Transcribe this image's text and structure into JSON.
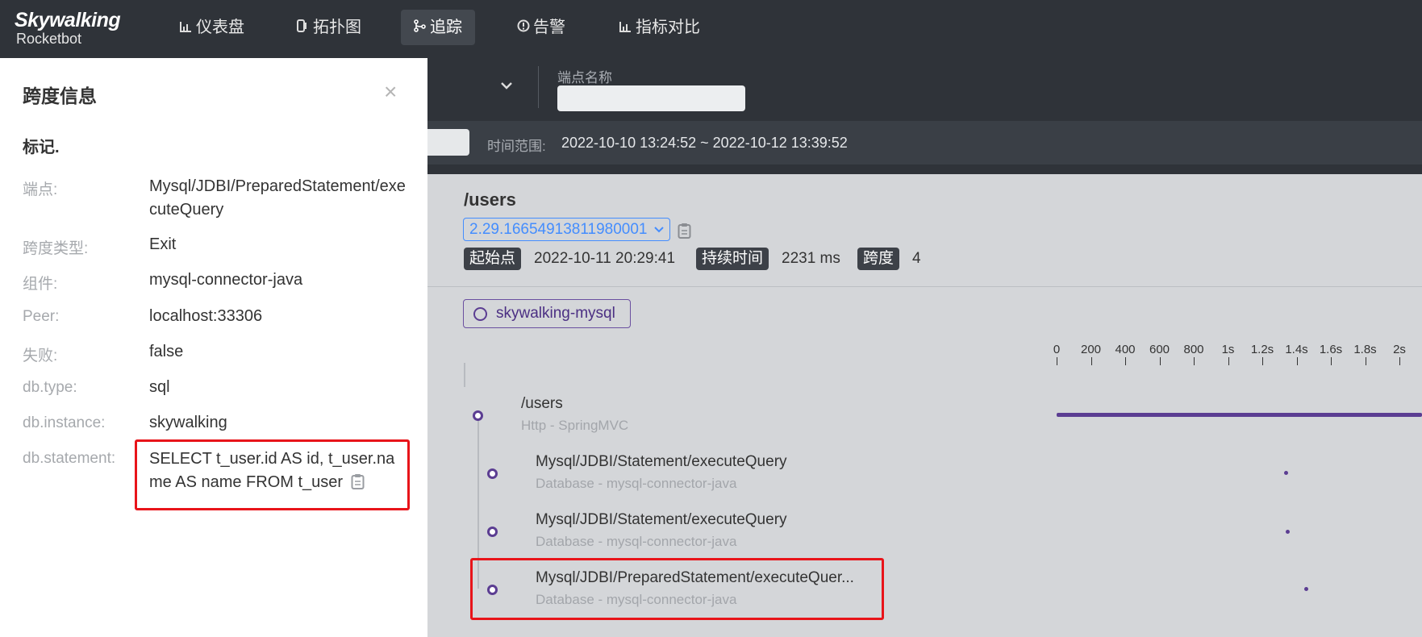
{
  "nav": {
    "logo_line1": "Skywalking",
    "logo_line2": "Rocketbot",
    "items": [
      {
        "label": "仪表盘",
        "icon": "bar-chart-icon"
      },
      {
        "label": "拓扑图",
        "icon": "topology-icon"
      },
      {
        "label": "追踪",
        "icon": "trace-icon",
        "active": true
      },
      {
        "label": "告警",
        "icon": "alarm-icon"
      },
      {
        "label": "指标对比",
        "icon": "compare-icon"
      }
    ]
  },
  "filters": {
    "endpoint_label": "端点名称",
    "endpoint_value": "",
    "time_label": "时间范围:",
    "time_value": "2022-10-10 13:24:52 ~ 2022-10-12 13:39:52"
  },
  "trace": {
    "title": "/users",
    "trace_id": "2.29.16654913811980001",
    "start_label": "起始点",
    "start_value": "2022-10-11 20:29:41",
    "duration_label": "持续时间",
    "duration_value": "2231 ms",
    "span_label": "跨度",
    "span_count": "4",
    "service": "skywalking-mysql",
    "axis": [
      "0",
      "200",
      "400",
      "600",
      "800",
      "1s",
      "1.2s",
      "1.4s",
      "1.6s",
      "1.8s",
      "2s"
    ],
    "spans": [
      {
        "name": "/users",
        "sub": "Http - SpringMVC"
      },
      {
        "name": "Mysql/JDBI/Statement/executeQuery",
        "sub": "Database - mysql-connector-java"
      },
      {
        "name": "Mysql/JDBI/Statement/executeQuery",
        "sub": "Database - mysql-connector-java"
      },
      {
        "name": "Mysql/JDBI/PreparedStatement/executeQuer...",
        "sub": "Database - mysql-connector-java"
      }
    ]
  },
  "panel": {
    "title": "跨度信息",
    "close": "×",
    "tags_heading": "标记.",
    "rows": [
      {
        "label": "端点:",
        "value": "Mysql/JDBI/PreparedStatement/executeQuery"
      },
      {
        "label": "跨度类型:",
        "value": "Exit"
      },
      {
        "label": "组件:",
        "value": "mysql-connector-java"
      },
      {
        "label": "Peer:",
        "value": "localhost:33306"
      },
      {
        "label": "失败:",
        "value": "false"
      },
      {
        "label": "db.type:",
        "value": "sql"
      },
      {
        "label": "db.instance:",
        "value": "skywalking"
      },
      {
        "label": "db.statement:",
        "value": "SELECT t_user.id AS id, t_user.name AS name FROM t_user"
      }
    ]
  }
}
